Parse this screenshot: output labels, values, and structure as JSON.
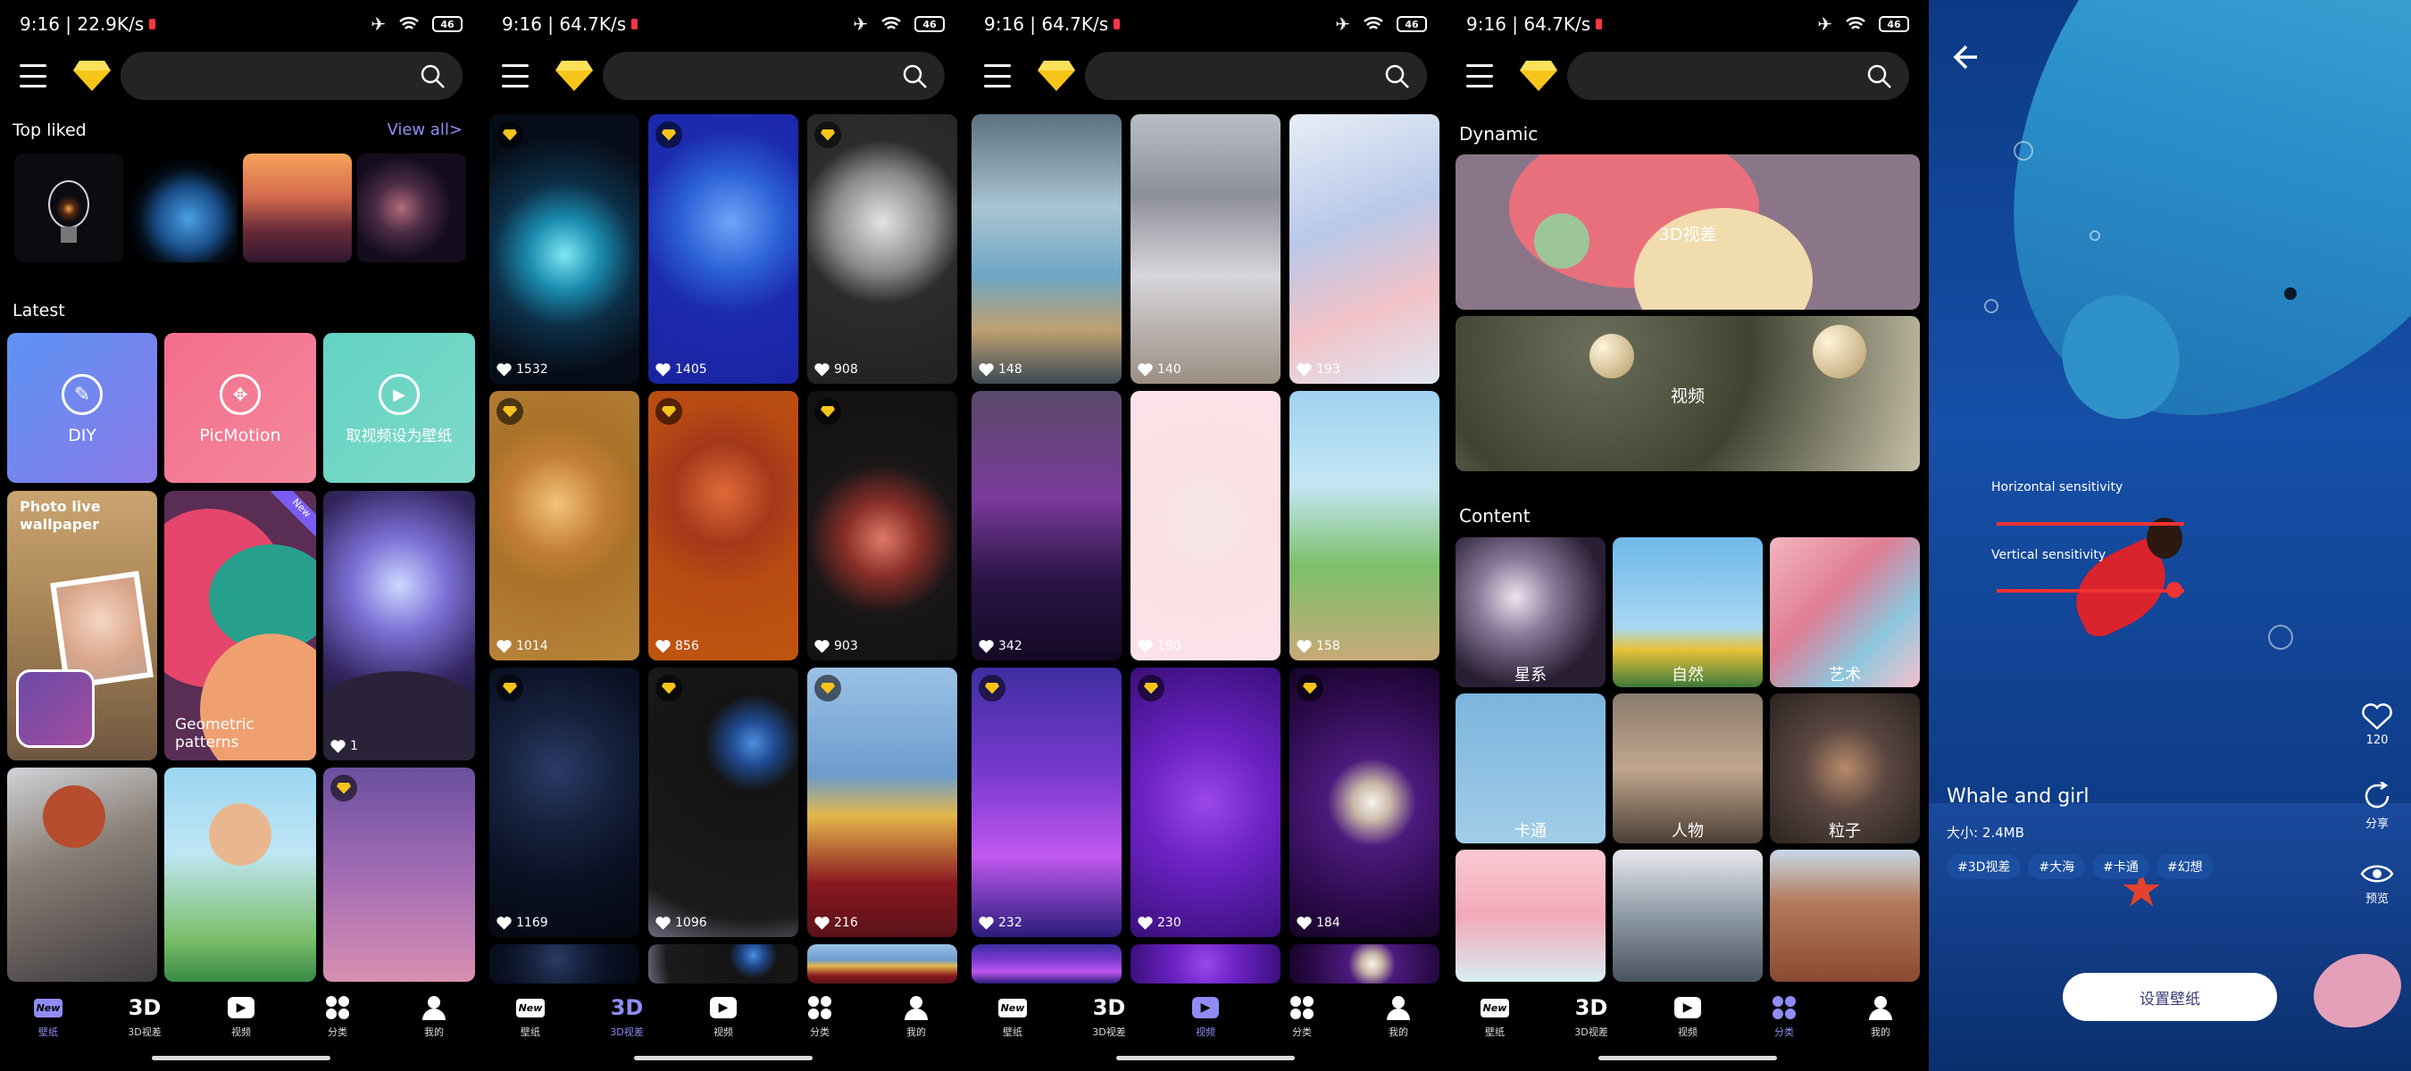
{
  "status_bars": [
    {
      "time": "9:16 | 22.9K/s",
      "battery": "46"
    },
    {
      "time": "9:16 | 64.7K/s",
      "battery": "46"
    },
    {
      "time": "9:16 | 64.7K/s",
      "battery": "46"
    },
    {
      "time": "9:16 | 64.7K/s",
      "battery": "46"
    }
  ],
  "nav_tabs": [
    "壁纸",
    "3D视差",
    "视频",
    "分类",
    "我的"
  ],
  "nav_glyphs": {
    "wallpaper": "New",
    "3d": "3D"
  },
  "home": {
    "top_liked": "Top liked",
    "view_all": "View all>",
    "latest": "Latest",
    "diy": "DIY",
    "picmotion": "PicMotion",
    "video_set": "取视频设为壁纸",
    "photo_live": "Photo live wallpaper",
    "geometric": "Geometric patterns",
    "new_badge": "New",
    "tile_like": "1"
  },
  "three_d": {
    "likes": [
      "1532",
      "1405",
      "908",
      "1014",
      "856",
      "903",
      "1169",
      "1096",
      "216"
    ]
  },
  "video": {
    "likes": [
      "148",
      "140",
      "193",
      "342",
      "190",
      "158",
      "232",
      "230",
      "184"
    ]
  },
  "category": {
    "dynamic": "Dynamic",
    "parallax": "3D视差",
    "video": "视频",
    "content": "Content",
    "cats": [
      "星系",
      "自然",
      "艺术",
      "卡通",
      "人物",
      "粒子"
    ]
  },
  "detail": {
    "title": "Whale and girl",
    "size": "大小: 2.4MB",
    "tags": [
      "#3D视差",
      "#大海",
      "#卡通",
      "#幻想"
    ],
    "h_sens": "Horizontal sensitivity",
    "v_sens": "Vertical sensitivity",
    "like_count": "120",
    "share": "分享",
    "preview": "预览",
    "set_button": "设置壁纸"
  },
  "colors": {
    "accent": "#8f8df5",
    "premium": "#f7c519",
    "detail_bg": "#0b3f8f"
  }
}
